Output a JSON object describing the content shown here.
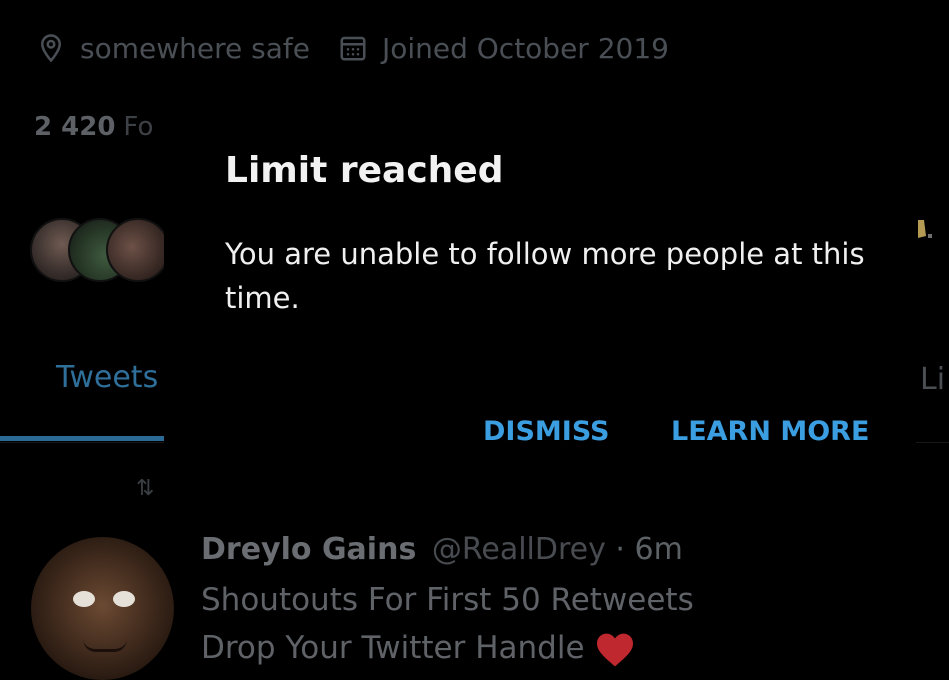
{
  "profile": {
    "location": "somewhere safe",
    "joined": "Joined October 2019",
    "followers_count": "2 420",
    "followers_label": "Fo",
    "icons": {
      "location": "location-pin-icon",
      "joined": "calendar-icon"
    }
  },
  "tabs": {
    "tweets": "Tweets",
    "likes": "Li"
  },
  "retweet_indicator": "retweet-icon",
  "tweet": {
    "author_name": "Dreylo Gains",
    "author_handle": "@ReallDrey",
    "separator": "·",
    "time": "6m",
    "line1": "Shoutouts For First 50 Retweets",
    "line2": "Drop Your Twitter Handle",
    "emoji": "heart-icon"
  },
  "dialog": {
    "title": "Limit reached",
    "body": "You are unable to follow more people at this time.",
    "dismiss_label": "DISMISS",
    "learn_more_label": "LEARN MORE"
  },
  "colors": {
    "accent": "#3b9ee0",
    "tab_underline": "#2b6a95",
    "background": "#000000",
    "heart": "#c0282f"
  }
}
